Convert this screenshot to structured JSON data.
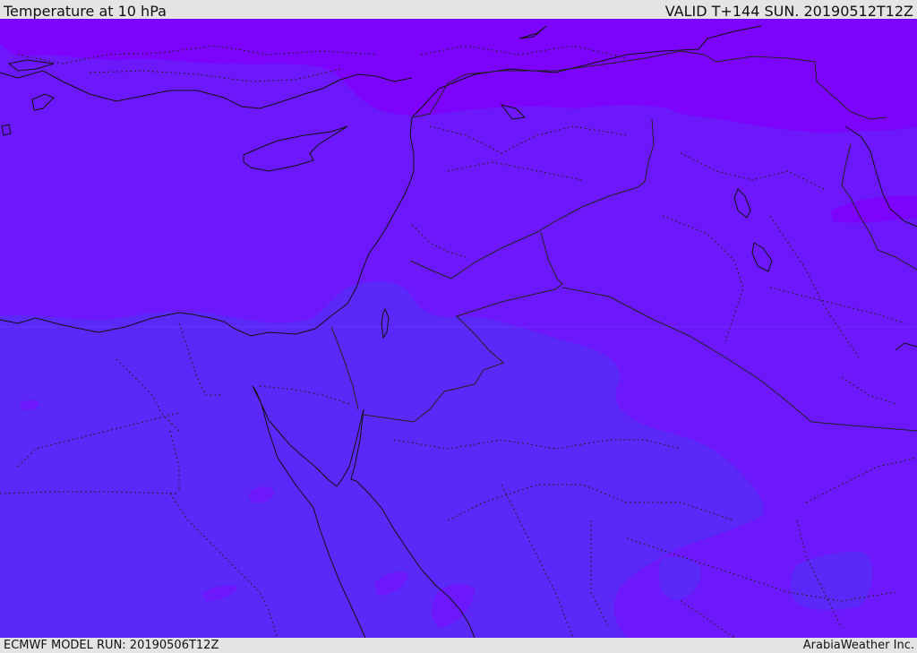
{
  "header": {
    "title": "Temperature at 10 hPa",
    "valid": "VALID T+144 SUN. 20190512T12Z"
  },
  "footer": {
    "model_run": "ECMWF MODEL RUN: 20190506T12Z",
    "credit": "ArabiaWeather Inc."
  },
  "map": {
    "field": "temperature",
    "level": "10 hPa",
    "colors": {
      "coldest": "#7c04fa",
      "cold": "#6c18fb",
      "mild": "#5a28f7",
      "coastline": "#111111",
      "border": "#222222"
    }
  }
}
